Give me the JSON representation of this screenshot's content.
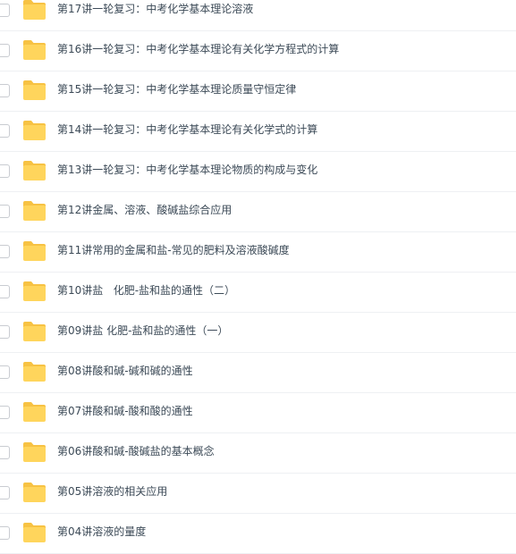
{
  "file_list": {
    "items": [
      {
        "name": "第17讲一轮复习：中考化学基本理论溶液"
      },
      {
        "name": "第16讲一轮复习：中考化学基本理论有关化学方程式的计算"
      },
      {
        "name": "第15讲一轮复习：中考化学基本理论质量守恒定律"
      },
      {
        "name": "第14讲一轮复习：中考化学基本理论有关化学式的计算"
      },
      {
        "name": "第13讲一轮复习：中考化学基本理论物质的构成与变化"
      },
      {
        "name": "第12讲金属、溶液、酸碱盐综合应用"
      },
      {
        "name": "第11讲常用的金属和盐-常见的肥料及溶液酸碱度"
      },
      {
        "name": "第10讲盐   化肥-盐和盐的通性（二）"
      },
      {
        "name": "第09讲盐 化肥-盐和盐的通性（一）"
      },
      {
        "name": "第08讲酸和碱-碱和碱的通性"
      },
      {
        "name": "第07讲酸和碱-酸和酸的通性"
      },
      {
        "name": "第06讲酸和碱-酸碱盐的基本概念"
      },
      {
        "name": "第05讲溶液的相关应用"
      },
      {
        "name": "第04讲溶液的量度"
      }
    ],
    "folder_icon": "folder-icon",
    "colors": {
      "folder": "#ffd55c",
      "folder_tab": "#f7c243",
      "text": "#3c4a57",
      "divider": "#eef0f3"
    }
  }
}
